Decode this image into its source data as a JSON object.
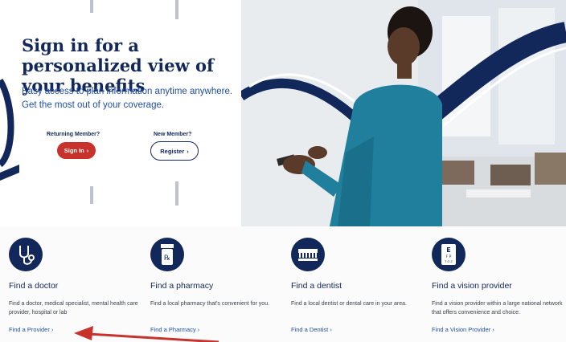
{
  "hero": {
    "title": "Sign in for a personalized view of your benefits",
    "subtitle_line1": "Easy access to plan information anytime anywhere.",
    "subtitle_line2": "Get the most out of your coverage.",
    "returning_label": "Returning Member?",
    "signin_label": "Sign In",
    "new_label": "New Member?",
    "register_label": "Register"
  },
  "cards": [
    {
      "title": "Find a doctor",
      "desc": "Find a doctor, medical specialist, mental health care provider, hospital or lab",
      "link": "Find a Provider",
      "icon": "stethoscope-icon"
    },
    {
      "title": "Find a pharmacy",
      "desc": "Find a local pharmacy that's convenient for you.",
      "link": "Find a Pharmacy",
      "icon": "pill-bottle-icon"
    },
    {
      "title": "Find a dentist",
      "desc": "Find a local dentist or dental care in your area.",
      "link": "Find a Dentist",
      "icon": "toothbrush-icon"
    },
    {
      "title": "Find a vision provider",
      "desc": "Find a vision provider within a large national network that offers convenience and choice.",
      "link": "Find a Vision Provider",
      "icon": "eye-chart-icon"
    }
  ],
  "colors": {
    "navy": "#13285a",
    "blue_link": "#1f4fa8",
    "red_button": "#c8322c",
    "teal_shirt": "#1f7f9c",
    "annotation_arrow": "#c8322c"
  },
  "icon_chars": {
    "chevron": "›",
    "rx": "℞",
    "eye_chart": "E",
    "eye_chart_row2": "F P",
    "eye_chart_row3": "T O Z"
  }
}
